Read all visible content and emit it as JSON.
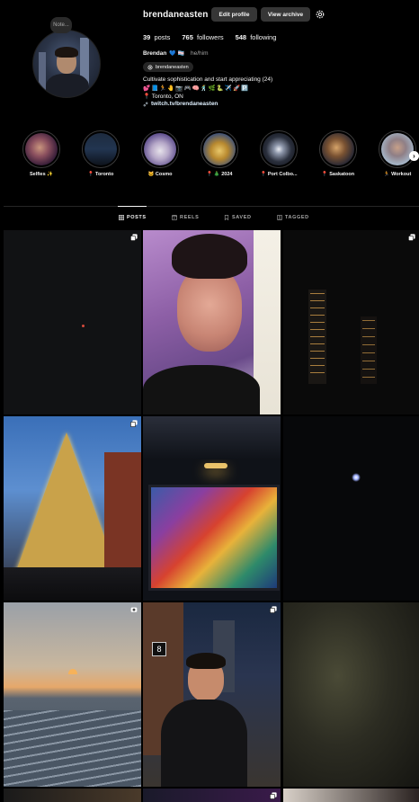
{
  "profile": {
    "username": "brendaneasten",
    "note": "Note...",
    "edit_label": "Edit profile",
    "archive_label": "View archive",
    "posts_count": "39",
    "posts_label": "posts",
    "followers_count": "765",
    "followers_label": "followers",
    "following_count": "548",
    "following_label": "following",
    "display_name": "Brendan",
    "name_emojis": "💙 🏳️‍⚧️",
    "pronouns": "he/him",
    "threads_handle": "brendaneasten",
    "bio_line1": "Cultivate sophistication and start appreciating (24)",
    "bio_line2": "💕📘🏃🤚📷🎮🧠🕺🌿🐍✈️🚀🅿️",
    "bio_line3": "📍 Toronto, ON",
    "link": "twitch.tv/brendaneasten"
  },
  "highlights": [
    {
      "label": "Selfies ✨"
    },
    {
      "label": "📍 Toronto"
    },
    {
      "label": "🐱 Cosmo"
    },
    {
      "label": "📍 🎄 2024"
    },
    {
      "label": "📍 Port Colbo..."
    },
    {
      "label": "📍 Saskatoon"
    },
    {
      "label": "🏃 Workout"
    }
  ],
  "tabs": [
    {
      "label": "POSTS",
      "icon": "grid-icon",
      "active": true
    },
    {
      "label": "REELS",
      "icon": "reels-icon",
      "active": false
    },
    {
      "label": "SAVED",
      "icon": "bookmark-icon",
      "active": false
    },
    {
      "label": "TAGGED",
      "icon": "tagged-icon",
      "active": false
    }
  ],
  "colors": {
    "background": "#000000",
    "button": "#363636",
    "muted_text": "#a8a8a8",
    "link_text": "#e0f1ff"
  }
}
